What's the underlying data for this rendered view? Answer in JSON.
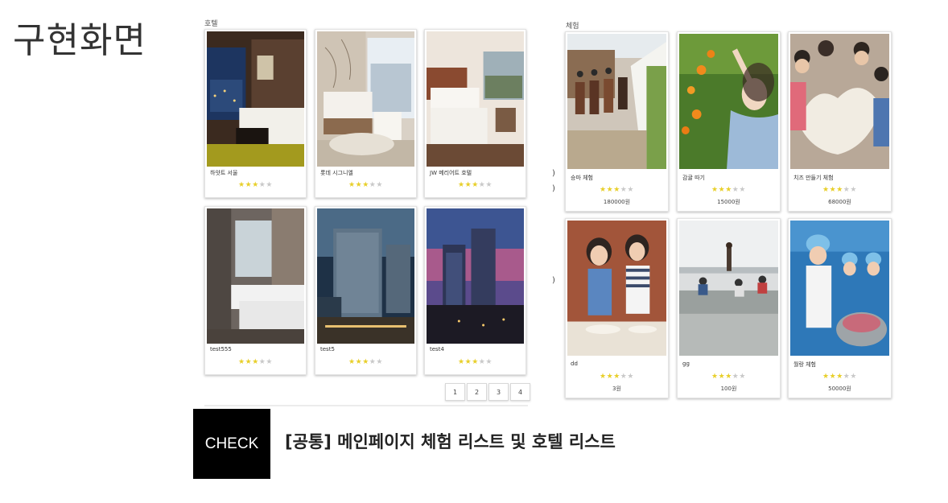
{
  "page_title": "구현화면",
  "hotel_section": {
    "label": "호텔",
    "cards": [
      {
        "name": "하얏트 서울",
        "rating": 3
      },
      {
        "name": "롯데 시그니엘",
        "rating": 3
      },
      {
        "name": "JW 메리어트 호텔",
        "rating": 3
      },
      {
        "name": "test555",
        "rating": 3
      },
      {
        "name": "test5",
        "rating": 3
      },
      {
        "name": "test4",
        "rating": 3
      }
    ],
    "pagination": [
      "1",
      "2",
      "3",
      "4"
    ]
  },
  "experience_section": {
    "label": "체험",
    "cards": [
      {
        "name": "승마 체험",
        "rating": 3,
        "price": "180000원"
      },
      {
        "name": "감귤 따기",
        "rating": 3,
        "price": "15000원"
      },
      {
        "name": "치즈 만들기 체험",
        "rating": 3,
        "price": "68000원"
      },
      {
        "name": "dd",
        "rating": 3,
        "price": "3원"
      },
      {
        "name": "gg",
        "rating": 3,
        "price": "100원"
      },
      {
        "name": "월랑 체험",
        "rating": 3,
        "price": "50000원"
      }
    ]
  },
  "stray_marks": [
    ")",
    ")",
    ")"
  ],
  "check_label": "CHECK",
  "caption": "[공통] 메인페이지 체험 리스트 및 호텔 리스트",
  "colors": {
    "star_on": "#e8cf2a",
    "star_off": "#c9c9c9",
    "check_bg": "#000000"
  }
}
